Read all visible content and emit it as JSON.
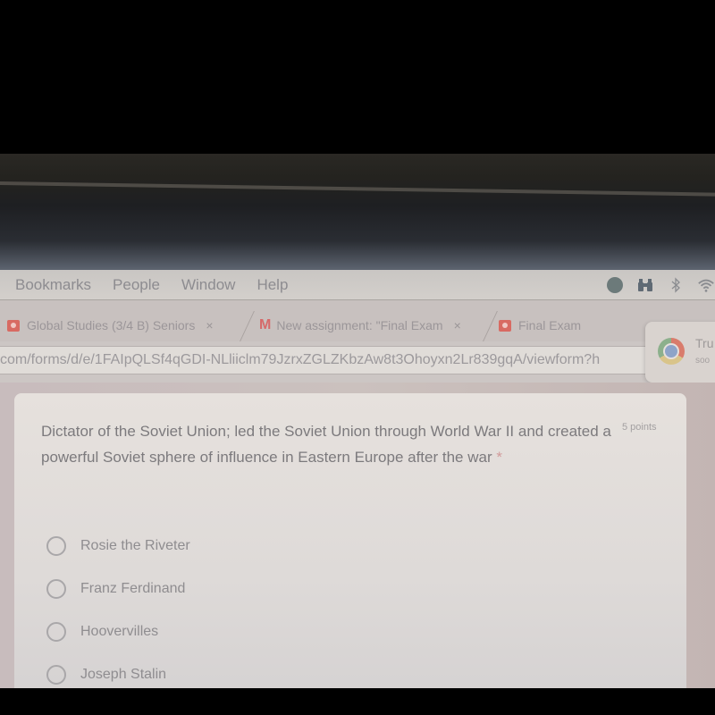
{
  "menubar": {
    "items": [
      "Bookmarks",
      "People",
      "Window",
      "Help"
    ],
    "status_icons": [
      "globe-icon",
      "binoculars-icon",
      "bluetooth-icon",
      "wifi-icon"
    ]
  },
  "tabs": [
    {
      "title": "Global Studies (3/4 B) Seniors",
      "favicon": "classroom-icon",
      "close": "×"
    },
    {
      "title": "New assignment: \"Final Exam",
      "favicon": "gmail-icon",
      "favicon_glyph": "M",
      "close": "×"
    },
    {
      "title": "Final Exam",
      "favicon": "forms-icon"
    }
  ],
  "address_bar": {
    "url": "com/forms/d/e/1FAIpQLSf4qGDI-NLliiclm79JzrxZGLZKbzAw8t3Ohoyxn2Lr839gqA/viewform?h"
  },
  "notification": {
    "title": "Tru",
    "subtitle": "soo",
    "icon": "chrome-icon"
  },
  "question": {
    "text": "Dictator of the Soviet Union; led the Soviet Union through World War II and created a powerful Soviet sphere of influence in Eastern Europe after the war",
    "required_marker": "*",
    "points": "5 points",
    "options": [
      "Rosie the Riveter",
      "Franz Ferdinand",
      "Hoovervilles",
      "Joseph Stalin"
    ],
    "selected": null
  },
  "colors": {
    "required": "#d29a9a",
    "gmail": "#d66a6a",
    "classroom": "#d86a62"
  }
}
